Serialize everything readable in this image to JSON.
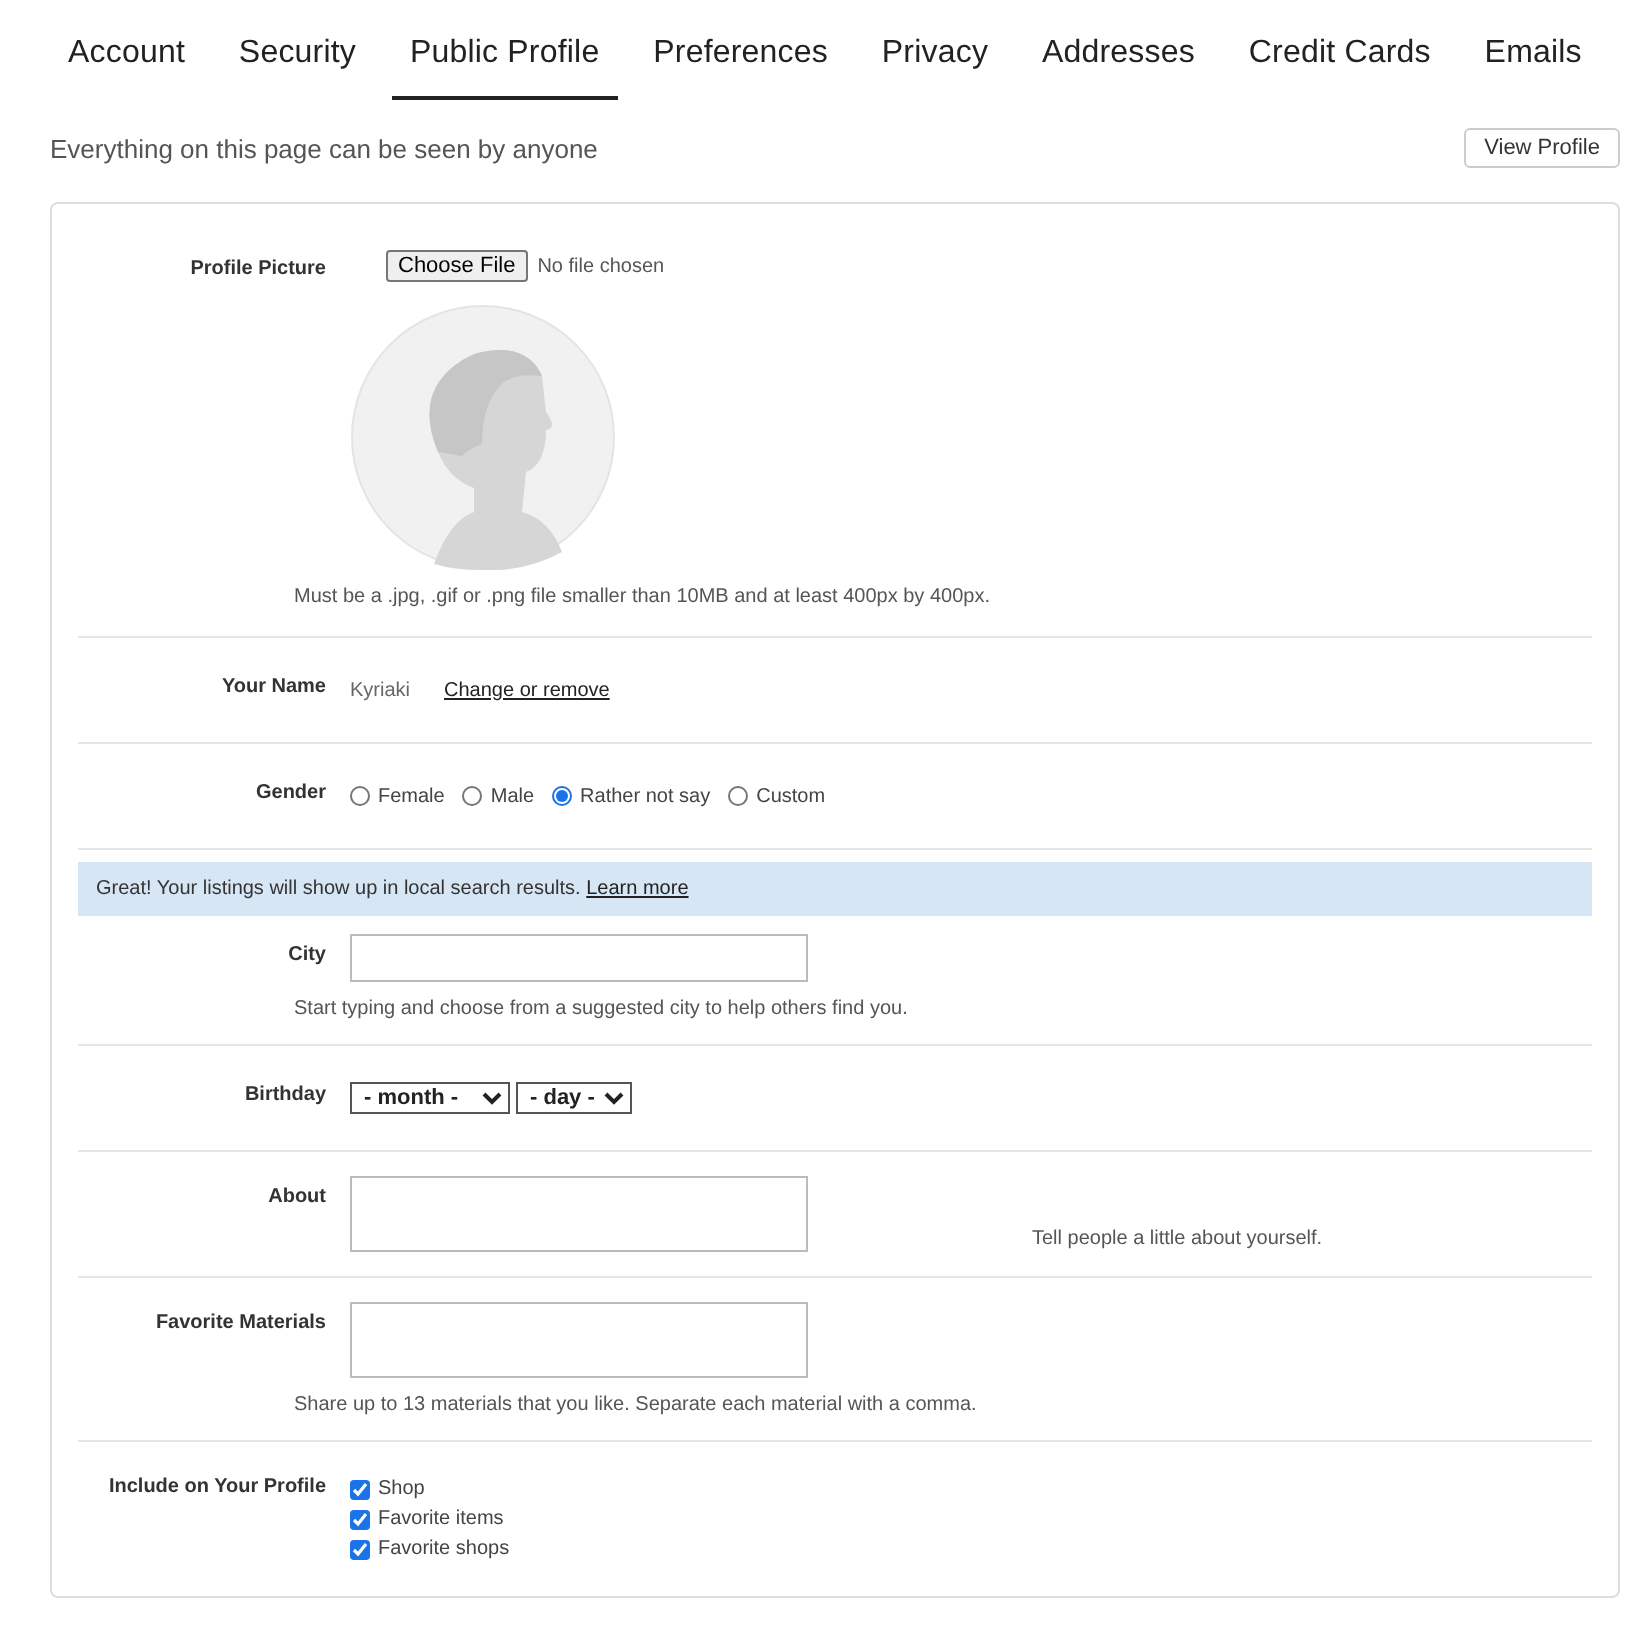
{
  "tabs": [
    {
      "label": "Account",
      "selected": false
    },
    {
      "label": "Security",
      "selected": false
    },
    {
      "label": "Public Profile",
      "selected": true
    },
    {
      "label": "Preferences",
      "selected": false
    },
    {
      "label": "Privacy",
      "selected": false
    },
    {
      "label": "Addresses",
      "selected": false
    },
    {
      "label": "Credit Cards",
      "selected": false
    },
    {
      "label": "Emails",
      "selected": false
    }
  ],
  "notice": "Everything on this page can be seen by anyone",
  "view_profile_button": "View Profile",
  "profile_picture": {
    "label": "Profile Picture",
    "button": "Choose File",
    "status": "No file chosen",
    "hint": "Must be a .jpg, .gif or .png file smaller than 10MB and at least 400px by 400px."
  },
  "name": {
    "label": "Your Name",
    "value": "Kyriaki",
    "link": "Change or remove"
  },
  "gender": {
    "label": "Gender",
    "options": [
      {
        "label": "Female",
        "selected": false
      },
      {
        "label": "Male",
        "selected": false
      },
      {
        "label": "Rather not say",
        "selected": true
      },
      {
        "label": "Custom",
        "selected": false
      }
    ]
  },
  "banner": {
    "text": "Great! Your listings will show up in local search results.",
    "link": "Learn more"
  },
  "city": {
    "label": "City",
    "hint": "Start typing and choose from a suggested city to help others find you."
  },
  "birthday": {
    "label": "Birthday",
    "month": "- month -",
    "day": "- day -"
  },
  "about": {
    "label": "About",
    "hint": "Tell people a little about yourself."
  },
  "materials": {
    "label": "Favorite Materials",
    "hint": "Share up to 13 materials that you like. Separate each material with a comma."
  },
  "include": {
    "label": "Include on Your Profile",
    "options": [
      {
        "label": "Shop",
        "checked": true
      },
      {
        "label": "Favorite items",
        "checked": true
      },
      {
        "label": "Favorite shops",
        "checked": true
      }
    ]
  }
}
